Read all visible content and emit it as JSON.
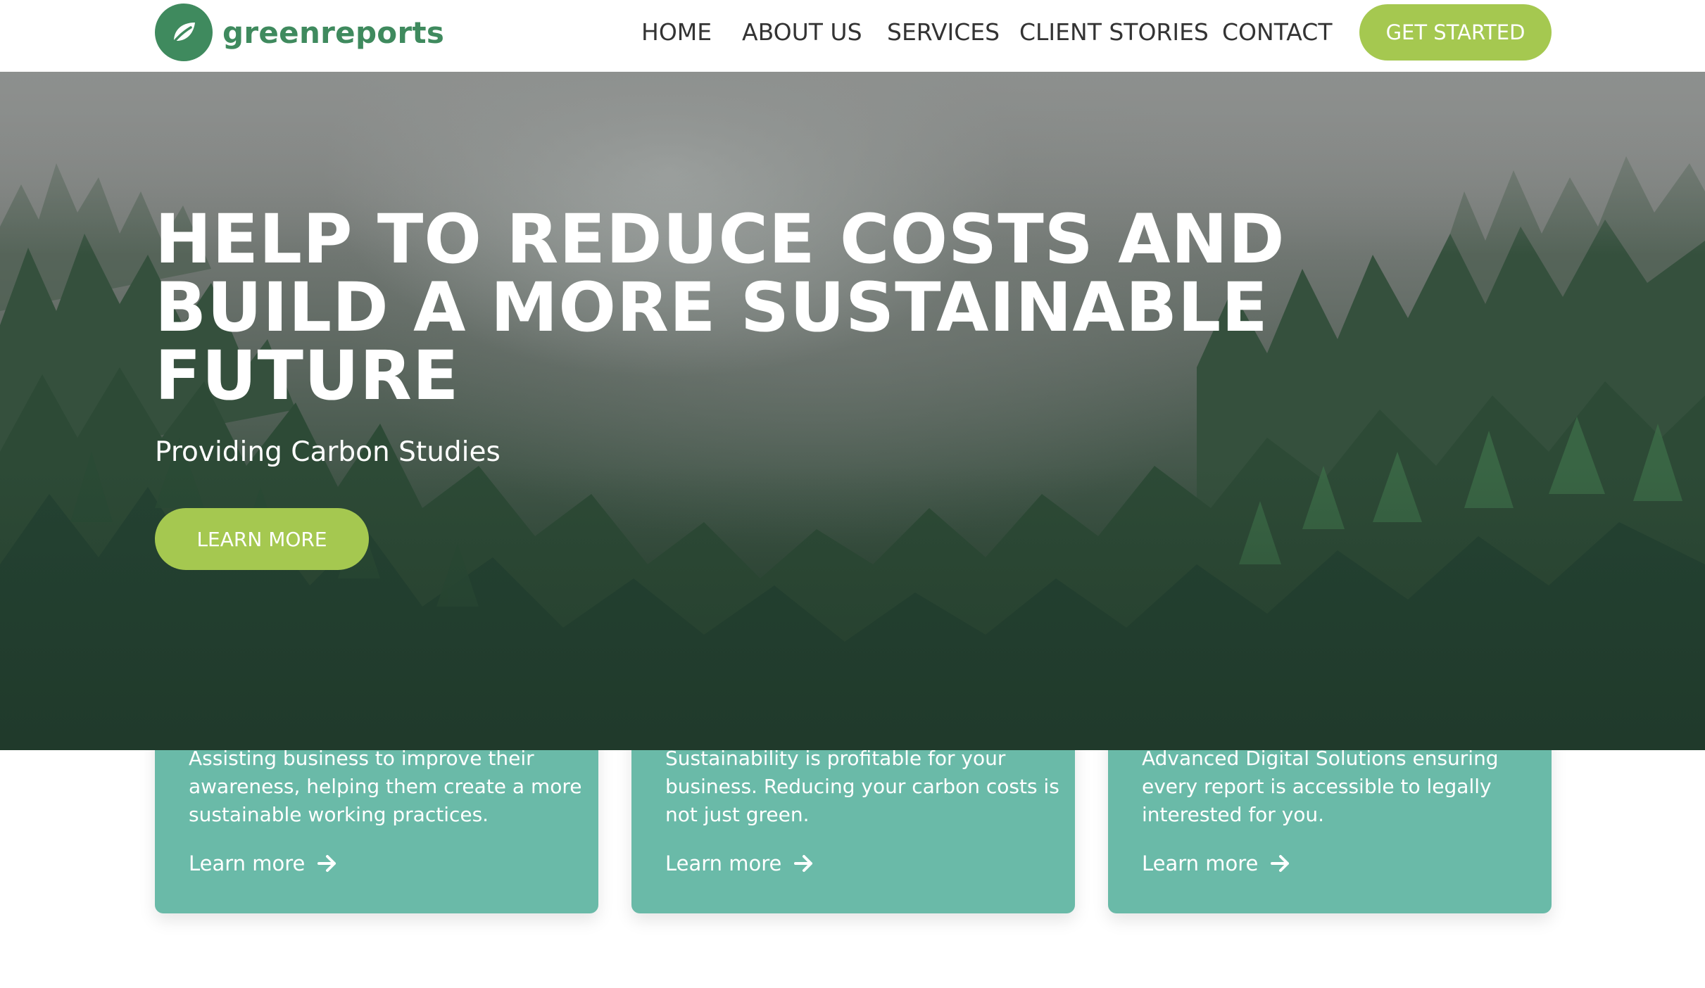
{
  "header": {
    "logo_text": "greenreports",
    "nav": [
      "HOME",
      "ABOUT US",
      "SERVICES",
      "CLIENT STORIES",
      "CONTACT"
    ],
    "cta_label": "GET STARTED",
    "logo_icon": "leaf-icon"
  },
  "hero": {
    "title_lines": [
      "HELP TO REDUCE COSTS AND",
      "BUILD A MORE SUSTAINABLE",
      "FUTURE"
    ],
    "subtitle": "Providing Carbon Studies",
    "button_label": "LEARN MORE"
  },
  "cards": [
    {
      "lines": [
        "Assisting business to improve their",
        "awareness, helping them create a more",
        "sustainable working practices."
      ],
      "link_label": "Learn more",
      "link_icon": "arrow-right-icon"
    },
    {
      "lines": [
        "Sustainability is profitable for your",
        "business. Reducing your carbon costs is",
        "not just green."
      ],
      "link_label": "Learn more",
      "link_icon": "arrow-right-icon"
    },
    {
      "lines": [
        "Advanced Digital Solutions ensuring",
        "every report is accessible to legally",
        "interested for you."
      ],
      "link_label": "Learn more",
      "link_icon": "arrow-right-icon"
    }
  ],
  "colors": {
    "brand_green": "#3f8a5e",
    "accent_lime": "#a5c850",
    "card_teal": "#6abaa8",
    "nav_text": "#333333"
  }
}
